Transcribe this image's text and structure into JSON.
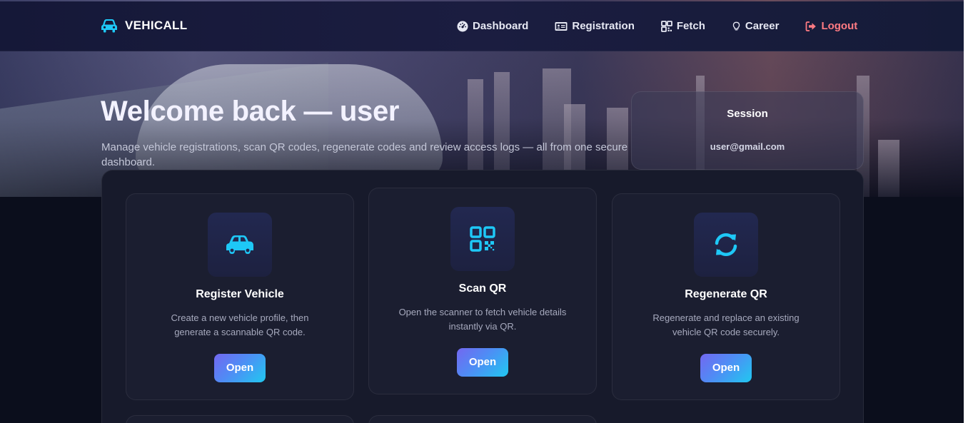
{
  "brand": {
    "name": "VEHICALL",
    "icon": "car-icon",
    "accent": "#1ec8f7"
  },
  "nav": {
    "items": [
      {
        "label": "Dashboard",
        "icon": "gauge-icon"
      },
      {
        "label": "Registration",
        "icon": "id-card-icon"
      },
      {
        "label": "Fetch",
        "icon": "grid-icon"
      },
      {
        "label": "Career",
        "icon": "lightbulb-icon"
      },
      {
        "label": "Logout",
        "icon": "logout-icon",
        "color": "#ff7b83"
      }
    ]
  },
  "hero": {
    "title": "Welcome back — user",
    "subtitle": "Manage vehicle registrations, scan QR codes, regenerate codes and review access logs — all from one secure dashboard."
  },
  "session": {
    "title": "Session",
    "email": "user@gmail.com"
  },
  "cards": [
    {
      "title": "Register Vehicle",
      "description": "Create a new vehicle profile, then generate a scannable QR code.",
      "button": "Open",
      "icon": "car-icon"
    },
    {
      "title": "Scan QR",
      "description": "Open the scanner to fetch vehicle details instantly via QR.",
      "button": "Open",
      "icon": "qr-code-icon"
    },
    {
      "title": "Regenerate QR",
      "description": "Regenerate and replace an existing vehicle QR code securely.",
      "button": "Open",
      "icon": "refresh-icon"
    }
  ],
  "colors": {
    "background": "#0b0e1c",
    "panel": "#171a2b",
    "button_gradient_start": "#7367f0",
    "button_gradient_end": "#20c8f0",
    "icon_accent": "#1ec8f7"
  }
}
